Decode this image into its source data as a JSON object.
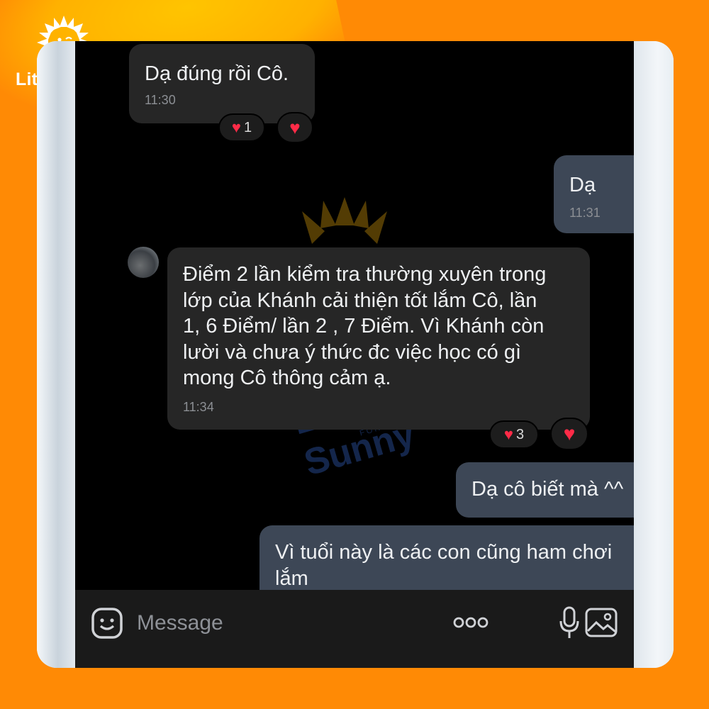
{
  "brand": {
    "name": "Little Sunny",
    "tagline": "FOR A BETTER WORLD",
    "primary_color": "#ff8a05",
    "accent_color": "#ffc400",
    "watermark_color": "#2e56a7"
  },
  "chat": {
    "messages": [
      {
        "direction": "incoming",
        "text": "Dạ đúng rồi Cô.",
        "time": "11:30",
        "reaction_count": "1",
        "reaction_icon": "heart-icon"
      },
      {
        "direction": "outgoing",
        "text": "Dạ",
        "time": "11:31"
      },
      {
        "direction": "incoming",
        "text": "Điểm 2 lần kiểm tra thường xuyên trong\nlớp của Khánh cải thiện tốt lắm Cô, lần\n1, 6 Điểm/ lần 2 , 7 Điểm. Vì Khánh còn\nlười và chưa ý thức đc việc học có gì\nmong Cô  thông cảm ạ.",
        "time": "11:34",
        "reaction_count": "3",
        "reaction_icon": "heart-icon"
      },
      {
        "direction": "outgoing",
        "text": "Dạ cô biết mà ^^"
      },
      {
        "direction": "outgoing",
        "text": "Vì tuổi này là các con cũng ham chơi\nlắm"
      }
    ],
    "bubble_colors": {
      "incoming": "#262626",
      "outgoing": "#3d4756"
    }
  },
  "composer": {
    "placeholder": "Message",
    "icons": [
      "sticker-icon",
      "more-icon",
      "microphone-icon",
      "image-icon"
    ]
  }
}
